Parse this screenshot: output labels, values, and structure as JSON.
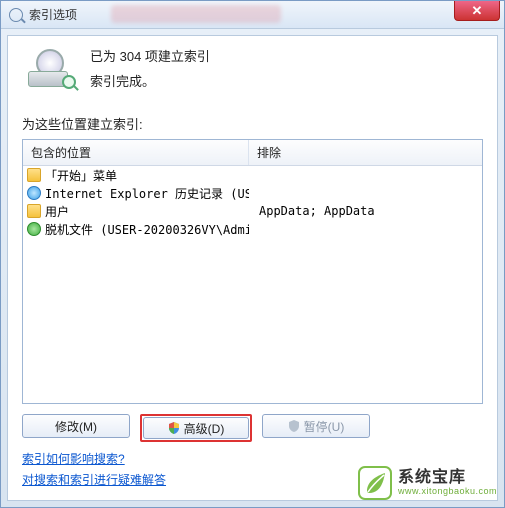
{
  "window": {
    "title": "索引选项"
  },
  "status": {
    "line1": "已为 304 项建立索引",
    "line2": "索引完成。"
  },
  "section_label": "为这些位置建立索引:",
  "columns": {
    "included": "包含的位置",
    "excluded": "排除"
  },
  "rows": [
    {
      "icon": "folder",
      "label": "「开始」菜单",
      "excluded": ""
    },
    {
      "icon": "ie",
      "label": "Internet Explorer 历史记录 (USE...",
      "excluded": ""
    },
    {
      "icon": "folder",
      "label": "用户",
      "excluded": "AppData; AppData"
    },
    {
      "icon": "offline",
      "label": "脱机文件 (USER-20200326VY\\Admin...",
      "excluded": ""
    }
  ],
  "buttons": {
    "modify": "修改(M)",
    "advanced": "高级(D)",
    "pause": "暂停(U)"
  },
  "links": {
    "how_affects": "索引如何影响搜索?",
    "troubleshoot": "对搜索和索引进行疑难解答"
  },
  "watermark": {
    "name": "系统宝库",
    "url": "www.xitongbaoku.com"
  }
}
